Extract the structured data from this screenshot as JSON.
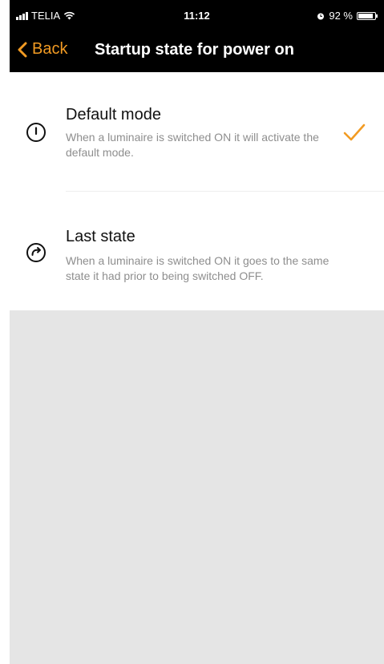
{
  "status_bar": {
    "carrier": "TELIA",
    "time": "11:12",
    "battery": "92 %",
    "battery_level": 0.92
  },
  "nav": {
    "back_label": "Back",
    "title": "Startup state for power on"
  },
  "options": [
    {
      "title": "Default mode",
      "description": "When a luminaire is switched ON it will activate the default mode.",
      "icon": "power-icon",
      "selected": true
    },
    {
      "title": "Last state",
      "description": "When a luminaire is switched ON it goes to the same state it had prior to being switched OFF.",
      "icon": "redo-icon",
      "selected": false
    }
  ],
  "colors": {
    "accent": "#f29b23",
    "topbar": "#000000",
    "background": "#e5e5e5",
    "secondary_text": "#8e8e8e"
  }
}
